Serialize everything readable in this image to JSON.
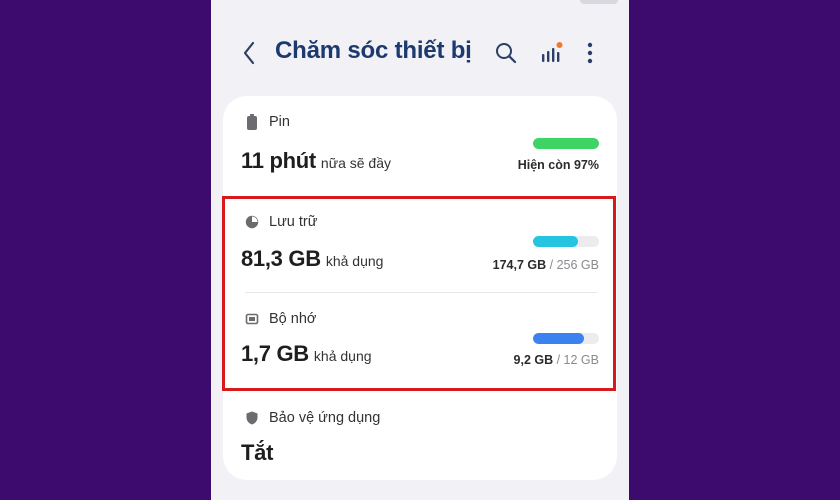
{
  "app": {
    "title": "Chăm sóc thiết bị"
  },
  "toolbar": {
    "back_icon": "back-chevron-icon",
    "search_icon": "search-icon",
    "stats_icon": "bar-chart-icon",
    "more_icon": "more-vert-icon"
  },
  "battery": {
    "label": "Pin",
    "value": "11 phút",
    "unit": "nữa sẽ đầy",
    "status": "Hiện còn 97%",
    "level_fraction": 1.0,
    "bar_color": "#3ed365"
  },
  "storage": {
    "label": "Lưu trữ",
    "value": "81,3 GB",
    "unit": "khả dụng",
    "used": "174,7 GB",
    "total": "/ 256 GB",
    "used_fraction": 0.68,
    "bar_color": "#25c4e0"
  },
  "memory": {
    "label": "Bộ nhớ",
    "value": "1,7 GB",
    "unit": "khả dụng",
    "used": "9,2 GB",
    "total": "/ 12 GB",
    "used_fraction": 0.77,
    "bar_color": "#3b82f0"
  },
  "app_protection": {
    "label": "Bảo vệ ứng dụng",
    "value": "Tắt"
  },
  "colors": {
    "page_bg": "#3d0a6e",
    "title": "#1d3a6e",
    "highlight_border": "#d71a1a",
    "dot_accent": "#f07a2a"
  }
}
